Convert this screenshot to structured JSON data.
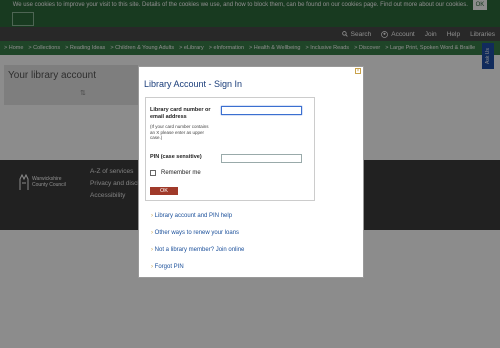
{
  "cookie_bar": {
    "text": "We use cookies to improve your visit to this site. Details of the cookies we use, and how to block them, can be found on our cookies page. Find out more about our cookies.",
    "ok_label": "OK"
  },
  "utility_nav": {
    "search": "Search",
    "account": "Account",
    "join": "Join",
    "help": "Help",
    "libraries": "Libraries"
  },
  "main_nav": [
    "Home",
    "Collections",
    "Reading Ideas",
    "Children & Young Adults",
    "eLibrary",
    "eInformation",
    "Health & Wellbeing",
    "Inclusive Reads",
    "Discover",
    "Large Print, Spoken Word & Braille"
  ],
  "ask_us": "Ask Us",
  "page": {
    "title": "Your library account"
  },
  "footer": {
    "logo_line1": "Warwickshire",
    "logo_line2": "County Council",
    "links": [
      "A-Z of services",
      "Privacy and disclaimer",
      "Accessibility"
    ]
  },
  "modal": {
    "title": "Library Account - Sign In",
    "card_label": "Library card number or email address",
    "card_hint": "(If your card number contains an X please enter as upper case.)",
    "card_value": "",
    "pin_label": "PIN (case sensitive)",
    "pin_value": "",
    "remember_label": "Remember me",
    "ok_label": "OK",
    "links": [
      "Library account and PIN help",
      "Other ways to renew your loans",
      "Not a library member? Join online",
      "Forgot PIN"
    ]
  },
  "colors": {
    "header_green": "#2d6a3b",
    "nav_green": "#3a7f49",
    "button_red": "#a03a2a",
    "link_blue": "#1a4f9a",
    "ask_blue": "#1f4fa8"
  }
}
